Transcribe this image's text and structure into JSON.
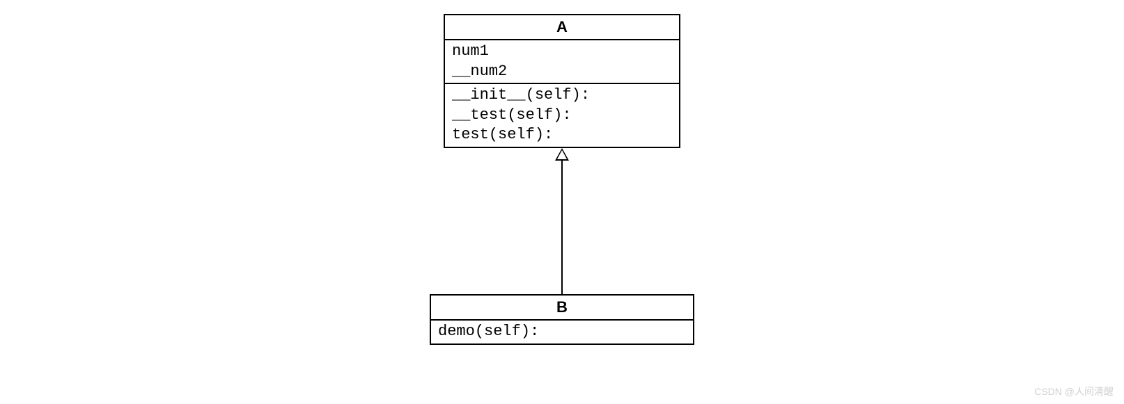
{
  "classA": {
    "name": "A",
    "attributes": [
      "num1",
      "__num2"
    ],
    "methods": [
      "__init__(self):",
      "__test(self):",
      "test(self):"
    ]
  },
  "classB": {
    "name": "B",
    "methods": [
      "demo(self):"
    ]
  },
  "relationship": "inheritance",
  "watermark": "CSDN @人间清醒"
}
